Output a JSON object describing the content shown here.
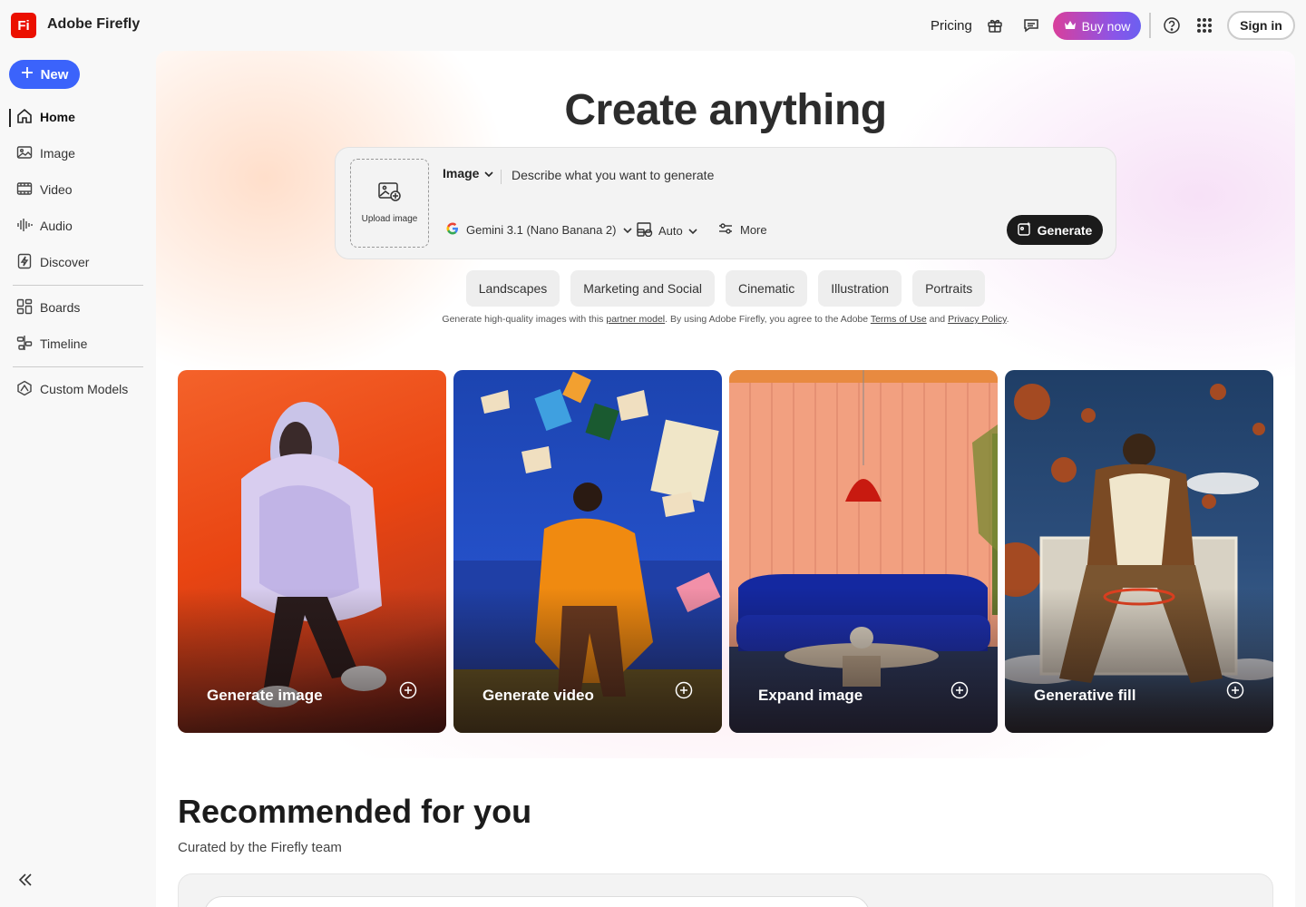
{
  "app": {
    "logo_text": "Fi",
    "title": "Adobe Firefly"
  },
  "topbar": {
    "pricing": "Pricing",
    "buy_now": "Buy now",
    "sign_in": "Sign in",
    "icons": [
      "gift-icon",
      "feedback-icon",
      "crown-icon",
      "help-icon",
      "apps-grid-icon"
    ]
  },
  "sidebar": {
    "new_button": "New",
    "items": [
      {
        "label": "Home",
        "icon": "home-icon",
        "active": true
      },
      {
        "label": "Image",
        "icon": "image-icon"
      },
      {
        "label": "Video",
        "icon": "video-icon"
      },
      {
        "label": "Audio",
        "icon": "audio-icon"
      },
      {
        "label": "Discover",
        "icon": "discover-icon"
      },
      {
        "label": "Boards",
        "icon": "boards-icon"
      },
      {
        "label": "Timeline",
        "icon": "timeline-icon"
      },
      {
        "label": "Custom Models",
        "icon": "custom-models-icon"
      }
    ],
    "collapse_icon": "collapse-sidebar-icon"
  },
  "hero": {
    "title": "Create anything",
    "upload_label": "Upload image",
    "mode": "Image",
    "prompt_placeholder": "Describe what you want to generate",
    "model": "Gemini 3.1 (Nano Banana 2)",
    "aspect": "Auto",
    "more": "More",
    "generate": "Generate",
    "chips": [
      "Landscapes",
      "Marketing and Social",
      "Cinematic",
      "Illustration",
      "Portraits"
    ],
    "legal": {
      "part1": "Generate high-quality images with this ",
      "partner_link": "partner model",
      "part2": ". By using Adobe Firefly, you agree to the Adobe ",
      "terms_link": "Terms of Use",
      "part3": " and ",
      "privacy_link": "Privacy Policy",
      "part4": "."
    }
  },
  "cards": [
    {
      "label": "Generate image"
    },
    {
      "label": "Generate video"
    },
    {
      "label": "Expand image"
    },
    {
      "label": "Generative fill"
    }
  ],
  "recommended": {
    "title": "Recommended for you",
    "subtitle": "Curated by the Firefly team"
  },
  "colors": {
    "brand": "#eb1000",
    "accent": "#3b63fb",
    "generate_button": "#1b1b1b"
  }
}
